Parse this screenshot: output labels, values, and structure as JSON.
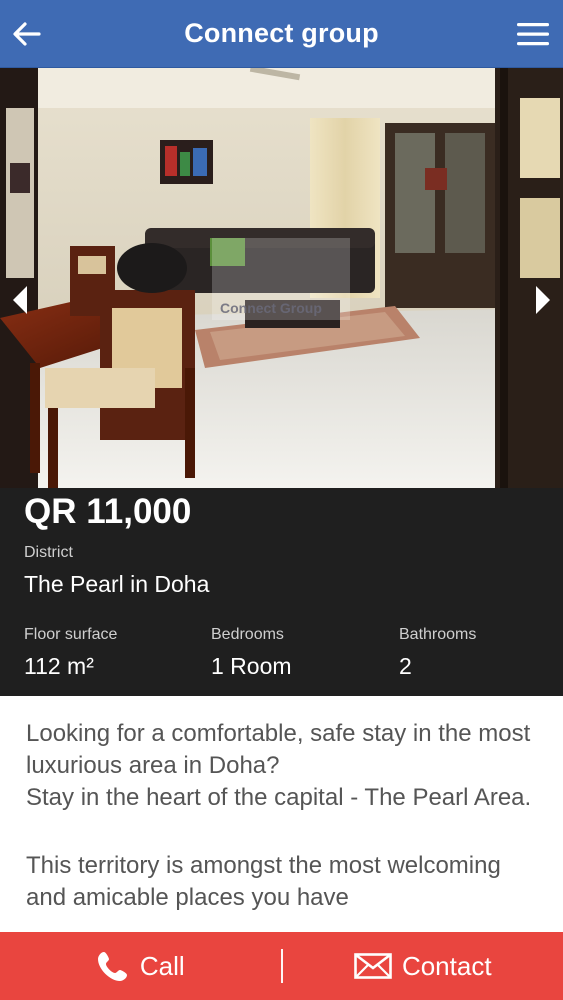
{
  "header": {
    "title": "Connect group",
    "back_icon": "arrow-left-icon",
    "menu_icon": "hamburger-menu-icon",
    "background_color": "#3f6bb4"
  },
  "listing": {
    "price": "QR 11,000",
    "district_label": "District",
    "district_value": "The Pearl in Doha",
    "floor_label": "Floor surface",
    "floor_value": "112 m²",
    "bedrooms_label": "Bedrooms",
    "bedrooms_value": "1 Room",
    "bathrooms_label": "Bathrooms",
    "bathrooms_value": "2"
  },
  "photo": {
    "watermark_text": "Connect Group",
    "prev_icon": "chevron-left-icon",
    "next_icon": "chevron-right-icon"
  },
  "description": {
    "paragraph_1": "Looking for a comfortable, safe stay in the most luxurious area in Doha?",
    "paragraph_2": "Stay in the heart of the capital - The Pearl Area.",
    "paragraph_3": "This territory is amongst the most welcoming and amicable places you have"
  },
  "actions": {
    "call_label": "Call",
    "call_icon": "phone-icon",
    "contact_label": "Contact",
    "contact_icon": "envelope-icon",
    "background_color": "#e9453f"
  }
}
